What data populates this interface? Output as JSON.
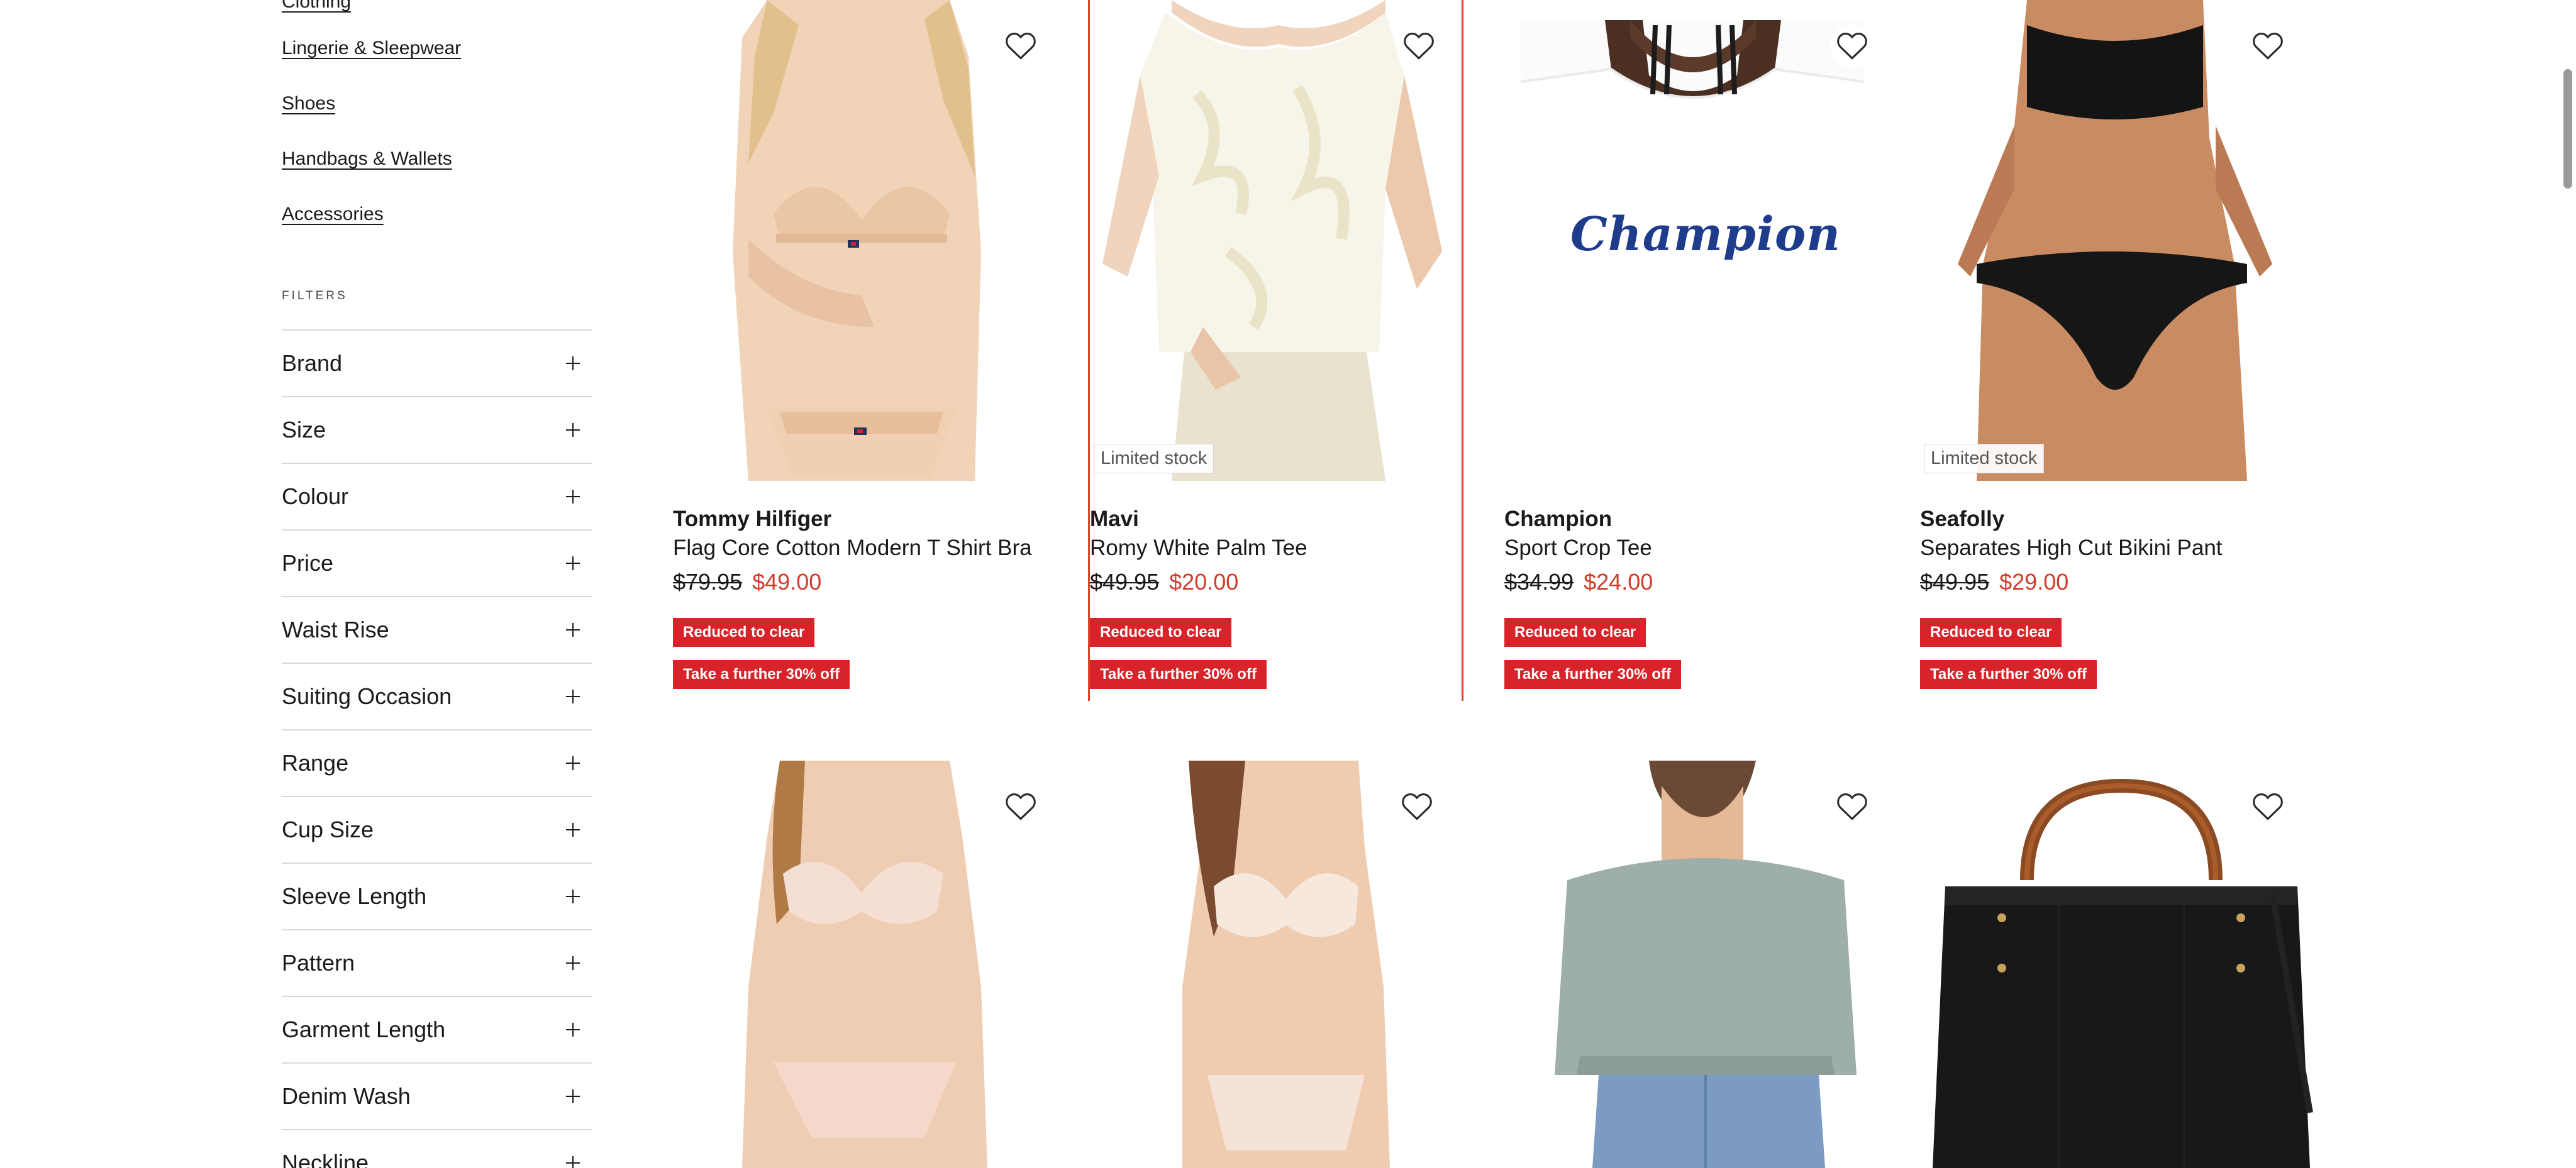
{
  "sidebar": {
    "categories": [
      {
        "label": "Clothing"
      },
      {
        "label": "Lingerie & Sleepwear"
      },
      {
        "label": "Shoes"
      },
      {
        "label": "Handbags & Wallets"
      },
      {
        "label": "Accessories"
      }
    ],
    "filters_heading": "FILTERS",
    "filters": [
      {
        "label": "Brand"
      },
      {
        "label": "Size"
      },
      {
        "label": "Colour"
      },
      {
        "label": "Price"
      },
      {
        "label": "Waist Rise"
      },
      {
        "label": "Suiting Occasion"
      },
      {
        "label": "Range"
      },
      {
        "label": "Cup Size"
      },
      {
        "label": "Sleeve Length"
      },
      {
        "label": "Pattern"
      },
      {
        "label": "Garment Length"
      },
      {
        "label": "Denim Wash"
      },
      {
        "label": "Neckline"
      }
    ]
  },
  "products": [
    {
      "brand": "Tommy Hilfiger",
      "name": "Flag Core Cotton Modern T Shirt Bra",
      "was_price": "$79.95",
      "now_price": "$49.00",
      "promo1": "Reduced to clear",
      "promo2": "Take a further 30% off"
    },
    {
      "brand": "Mavi",
      "name": "Romy White Palm Tee",
      "was_price": "$49.95",
      "now_price": "$20.00",
      "stock_badge": "Limited stock",
      "promo1": "Reduced to clear",
      "promo2": "Take a further 30% off"
    },
    {
      "brand": "Champion",
      "name": "Sport Crop Tee",
      "was_price": "$34.99",
      "now_price": "$24.00",
      "shirt_logo": "Champion",
      "promo1": "Reduced to clear",
      "promo2": "Take a further 30% off"
    },
    {
      "brand": "Seafolly",
      "name": "Separates High Cut Bikini Pant",
      "was_price": "$49.95",
      "now_price": "$29.00",
      "stock_badge": "Limited stock",
      "promo1": "Reduced to clear",
      "promo2": "Take a further 30% off"
    }
  ],
  "colors": {
    "sale_price": "#d23c2a",
    "promo_background": "#d8232a",
    "highlight_border": "#e0452c"
  },
  "icons": {
    "wishlist": "heart-icon",
    "expand": "plus-icon"
  }
}
